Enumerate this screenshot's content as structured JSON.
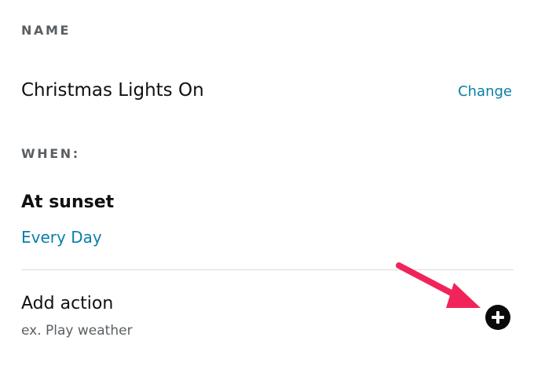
{
  "name_section": {
    "label": "NAME",
    "value": "Christmas Lights On",
    "change_label": "Change"
  },
  "when_section": {
    "label": "WHEN:",
    "trigger_title": "At sunset",
    "trigger_schedule": "Every Day"
  },
  "action_section": {
    "title": "Add action",
    "hint": "ex. Play weather",
    "add_icon": "plus-circle-icon"
  },
  "annotation": {
    "arrow_icon": "annotation-arrow-icon",
    "arrow_color": "#f0245a"
  },
  "colors": {
    "link": "#0a7ea8",
    "section_label": "#5a5f63",
    "primary_text": "#0f1111",
    "divider": "#dcdcdc"
  }
}
